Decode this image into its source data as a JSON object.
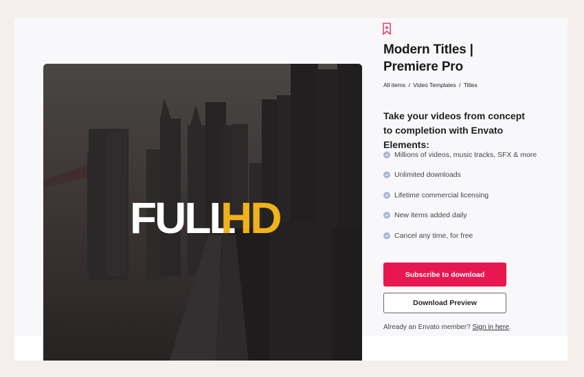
{
  "product": {
    "title": "Modern Titles | Premiere Pro",
    "breadcrumbs": [
      "All items",
      "Video Templates",
      "Titles"
    ],
    "breadcrumb_sep": "/"
  },
  "preview": {
    "text_white": "FULL",
    "text_yellow": "HD",
    "accent": "#f0b21b"
  },
  "pitch": {
    "headline": "Take your videos from concept to completion with Envato Elements:",
    "features": [
      "Millions of videos, music tracks, SFX & more",
      "Unlimited downloads",
      "Lifetime commercial licensing",
      "New items added daily",
      "Cancel any time, for free"
    ]
  },
  "actions": {
    "subscribe": "Subscribe to download",
    "preview": "Download Preview"
  },
  "member": {
    "prompt": "Already an Envato member?",
    "link": "Sign in here",
    "period": "."
  },
  "colors": {
    "brand": "#e8174f",
    "check": "#a9b6d8",
    "page_bg": "#f4efec"
  },
  "icons": [
    "bookmark-icon",
    "check-icon"
  ]
}
